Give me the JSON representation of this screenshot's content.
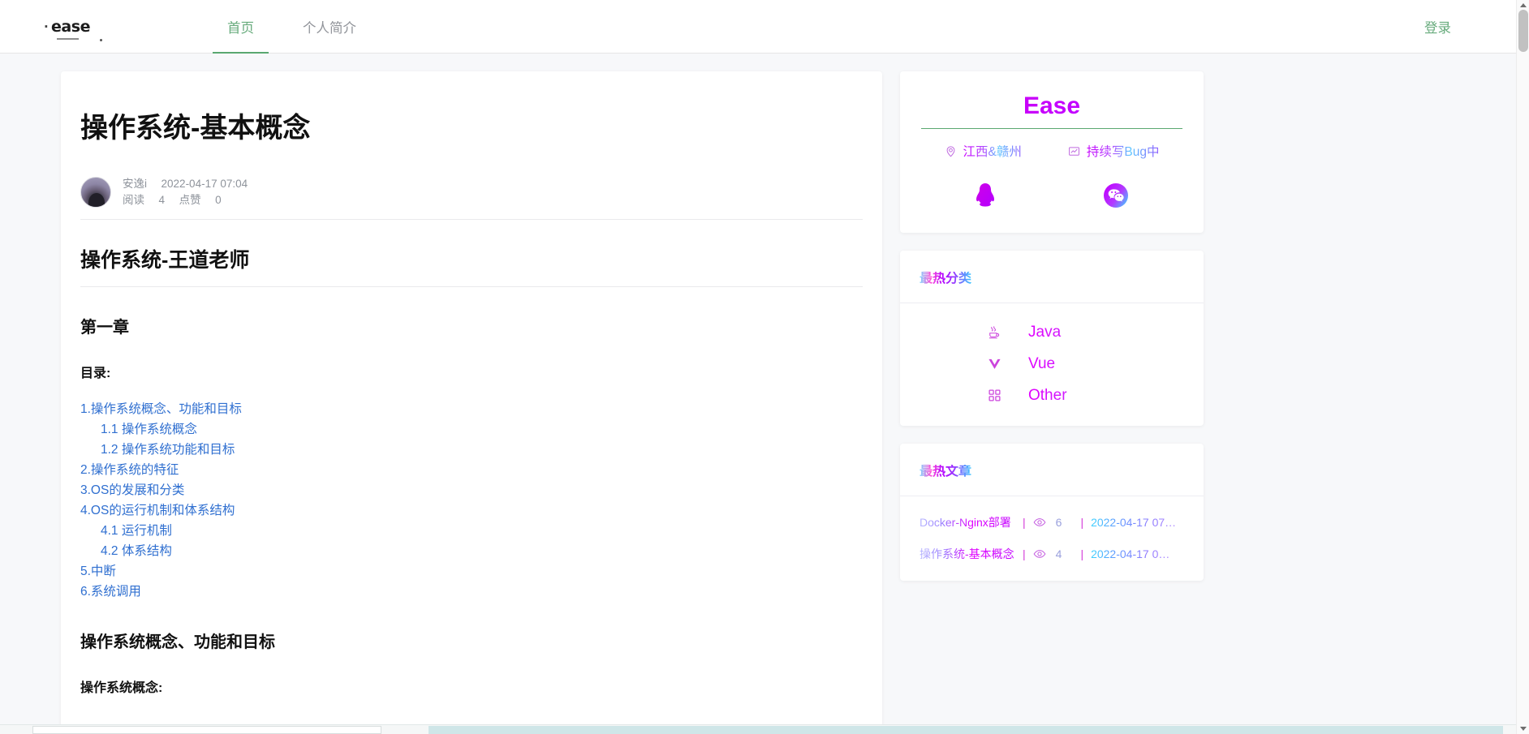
{
  "navbar": {
    "brand": "ease",
    "tabs": [
      {
        "label": "首页",
        "active": true
      },
      {
        "label": "个人简介",
        "active": false
      }
    ],
    "login": "登录"
  },
  "article": {
    "title": "操作系统-基本概念",
    "author": "安逸i",
    "date": "2022-04-17 07:04",
    "read_label": "阅读",
    "read_count": "4",
    "like_label": "点赞",
    "like_count": "0",
    "heading_1": "操作系统-王道老师",
    "heading_2": "第一章",
    "toc_label": "目录:",
    "toc": [
      {
        "text": "1.操作系统概念、功能和目标",
        "indent": false
      },
      {
        "text": "1.1 操作系统概念",
        "indent": true
      },
      {
        "text": "1.2 操作系统功能和目标",
        "indent": true
      },
      {
        "text": "2.操作系统的特征",
        "indent": false
      },
      {
        "text": "3.OS的发展和分类",
        "indent": false
      },
      {
        "text": "4.OS的运行机制和体系结构",
        "indent": false
      },
      {
        "text": "4.1 运行机制",
        "indent": true
      },
      {
        "text": "4.2 体系结构",
        "indent": true
      },
      {
        "text": "5.中断",
        "indent": false
      },
      {
        "text": "6.系统调用",
        "indent": false
      }
    ],
    "heading_3": "操作系统概念、功能和目标",
    "heading_4": "操作系统概念:"
  },
  "profile": {
    "name": "Ease",
    "location_icon": "location-pin-icon",
    "location": "江西&赣州",
    "status_icon": "monitor-chart-icon",
    "status": "持续写Bug中",
    "qq_icon": "qq-penguin-icon",
    "wechat_icon": "wechat-icon"
  },
  "categories": {
    "title": "最热分类",
    "items": [
      {
        "label": "Java",
        "icon": "java-coffee-icon"
      },
      {
        "label": "Vue",
        "icon": "vue-triangle-icon"
      },
      {
        "label": "Other",
        "icon": "grid-squares-icon"
      }
    ]
  },
  "hot_articles": {
    "title": "最热文章",
    "separator": "|",
    "items": [
      {
        "title": "Docker-Nginx部署",
        "views": "6",
        "date": "2022-04-17 07…"
      },
      {
        "title": "操作系统-基本概念",
        "views": "4",
        "date": "2022-04-17 0…"
      }
    ]
  },
  "colors": {
    "accent_green": "#5aa870",
    "link_blue": "#2f6fd0",
    "magenta": "#c800ff",
    "cyan": "#3bd2ff"
  }
}
